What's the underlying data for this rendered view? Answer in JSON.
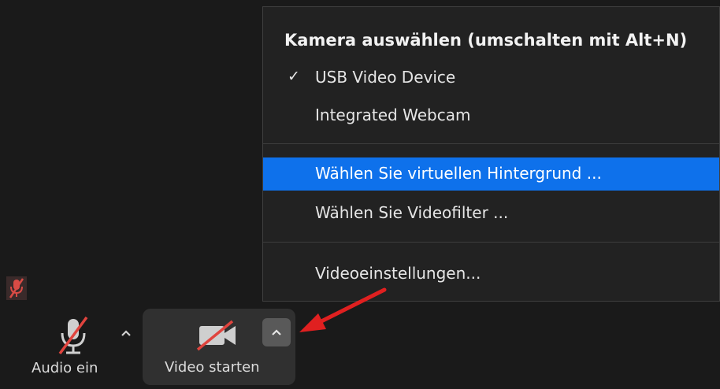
{
  "menu": {
    "title": "Kamera auswählen (umschalten mit Alt+N)",
    "cameras": [
      {
        "label": "USB Video Device",
        "checked": true
      },
      {
        "label": "Integrated Webcam",
        "checked": false
      }
    ],
    "check_mark": "✓",
    "background_items": [
      {
        "label": "Wählen Sie virtuellen Hintergrund ...",
        "highlighted": true
      },
      {
        "label": "Wählen Sie Videofilter ...",
        "highlighted": false
      }
    ],
    "settings_item": "Videoeinstellungen...",
    "highlight_color": "#0e71eb"
  },
  "toolbar": {
    "audio": {
      "label": "Audio ein",
      "icon": "microphone-muted-icon",
      "caret": "caret-up-icon"
    },
    "video": {
      "label": "Video starten",
      "icon": "camera-off-icon",
      "caret": "caret-up-icon"
    }
  },
  "annotation": {
    "icon": "red-arrow",
    "color": "#e02020"
  },
  "colors": {
    "background": "#1a1a1a",
    "menu_bg": "#222222",
    "mute_red": "#e0443e"
  }
}
